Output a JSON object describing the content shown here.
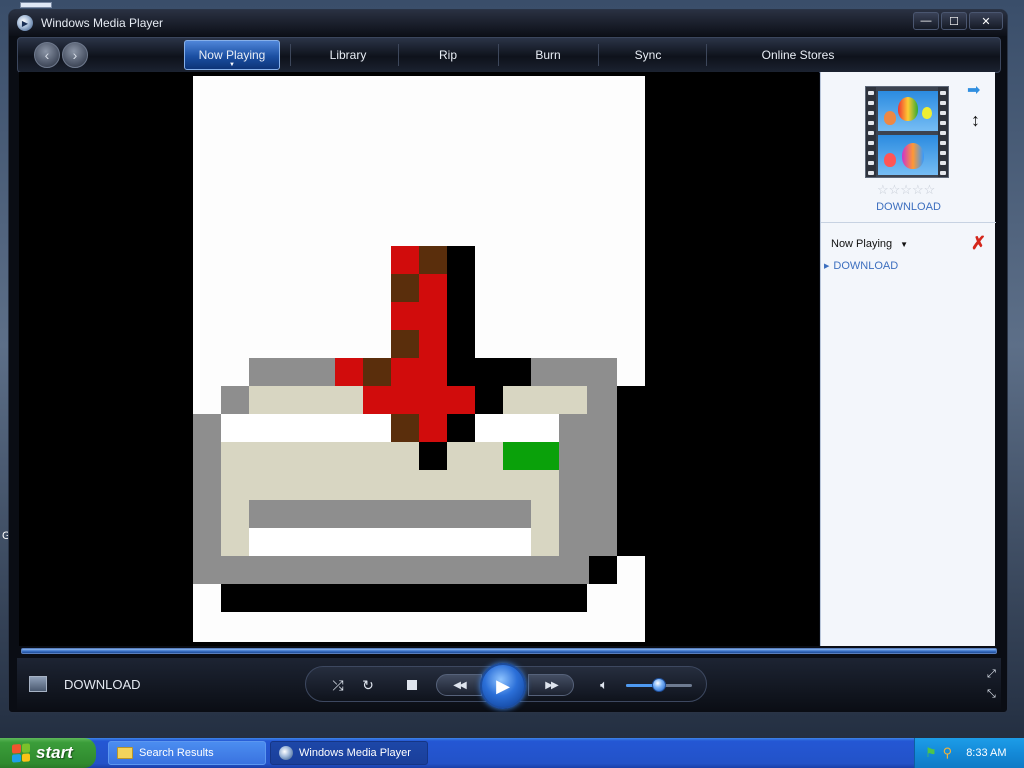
{
  "window": {
    "title": "Windows Media Player",
    "controls": {
      "minimize": "—",
      "maximize": "☐",
      "close": "✕"
    }
  },
  "nav": {
    "back": "‹",
    "forward": "›",
    "tabs": [
      {
        "label": "Now Playing",
        "active": true
      },
      {
        "label": "Library",
        "active": false
      },
      {
        "label": "Rip",
        "active": false
      },
      {
        "label": "Burn",
        "active": false
      },
      {
        "label": "Sync",
        "active": false
      },
      {
        "label": "Online Stores",
        "active": false
      }
    ]
  },
  "right_pane": {
    "art_caption": "DOWNLOAD",
    "rating_stars": "☆☆☆☆☆",
    "playlist_header": "Now Playing",
    "playlist_items": [
      {
        "label": "DOWNLOAD"
      }
    ]
  },
  "controls": {
    "media_title": "DOWNLOAD",
    "volume": 0.5
  },
  "taskbar": {
    "start_label": "start",
    "tasks": [
      {
        "label": "Search Results"
      },
      {
        "label": "Windows Media Player"
      }
    ],
    "clock": "8:33 AM"
  },
  "colors": {
    "accent_blue": "#2b6fd8",
    "taskbar_blue": "#2352c8",
    "start_green": "#3b9d3a",
    "pixel_red": "#d10c0c",
    "pixel_brown": "#5a2e0c",
    "pixel_gray": "#8e8e8e",
    "pixel_beige": "#d8d6c2",
    "pixel_green": "#0aa10a"
  }
}
